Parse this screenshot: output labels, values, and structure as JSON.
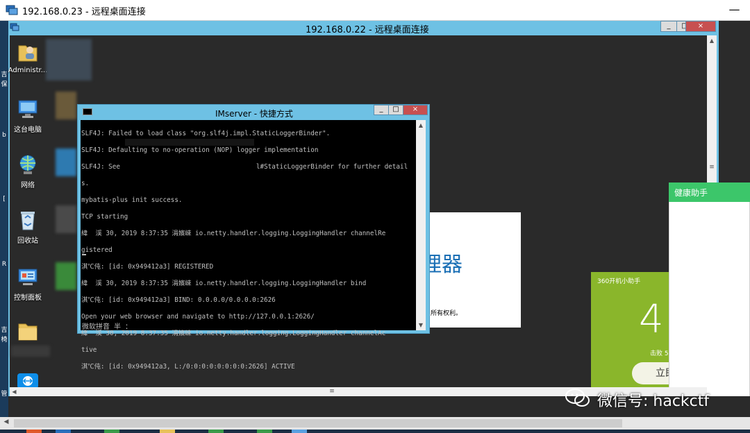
{
  "outer_window": {
    "title": "192.168.0.23 - 远程桌面连接",
    "minimize_label": "—"
  },
  "outer_left_strip_chars": [
    "吉",
    "保",
    "b",
    "[",
    "R",
    "吉",
    "椅",
    "管"
  ],
  "inner_window": {
    "title": "192.168.0.22 - 远程桌面连接",
    "minimize_label": "_",
    "restore_label": "□",
    "close_label": "×"
  },
  "desktop_icons": [
    {
      "label": "Administr...",
      "icon": "user-folder-icon"
    },
    {
      "label": "这台电脑",
      "icon": "computer-icon"
    },
    {
      "label": "网络",
      "icon": "network-icon"
    },
    {
      "label": "回收站",
      "icon": "recycle-bin-icon"
    },
    {
      "label": "控制面板",
      "icon": "control-panel-icon"
    },
    {
      "label": "",
      "icon": "folder-icon"
    },
    {
      "label": "",
      "icon": "teamviewer-icon"
    }
  ],
  "console": {
    "title": "IMserver - 快捷方式",
    "minimize_label": "_",
    "restore_label": "□",
    "close_label": "×",
    "lines": [
      "SLF4J: Failed to load class \"org.slf4j.impl.StaticLoggerBinder\".",
      "SLF4J: Defaulting to no-operation (NOP) logger implementation",
      "SLF4J: See                                   l#StaticLoggerBinder for further detail",
      "s.",
      "mybatis-plus init success.",
      "TCP starting",
      "緯  渓 30, 2019 8:37:35 涓嬪崍 io.netty.handler.logging.LoggingHandler channelRe",
      "gistered",
      "淇℃伅: [id: 0x949412a3] REGISTERED",
      "緯  渓 30, 2019 8:37:35 涓嬪崍 io.netty.handler.logging.LoggingHandler bind",
      "淇℃伅: [id: 0x949412a3] BIND: 0.0.0.0/0.0.0.0:2626",
      "Open your web browser and navigate to http://127.0.0.1:2626/",
      "緯  渓 30, 2019 8:37:35 涓嬪崍 io.netty.handler.logging.LoggingHandler channelAc",
      "tive",
      "淇℃伅: [id: 0x949412a3, L:/0:0:0:0:0:0:0:0:2626] ACTIVE"
    ],
    "ime_status": "微软拼音 半 ："
  },
  "background_dialog": {
    "big_text": "理器",
    "rights_text": "所有权利。"
  },
  "helper_360": {
    "title": "360开机小助手",
    "big_number": "4",
    "sub_text": "击败 5",
    "button_label": "立即"
  },
  "health_assistant": {
    "title": "健康助手"
  },
  "scrollbar_grip": "≡",
  "watermark": {
    "text": "微信号: hackctf"
  },
  "colors": {
    "window_frame": "#6ec1e4",
    "console_bg": "#000000",
    "helper_360_bg": "#8ab62b",
    "health_header": "#3cc66a",
    "close_red": "#c75050"
  }
}
